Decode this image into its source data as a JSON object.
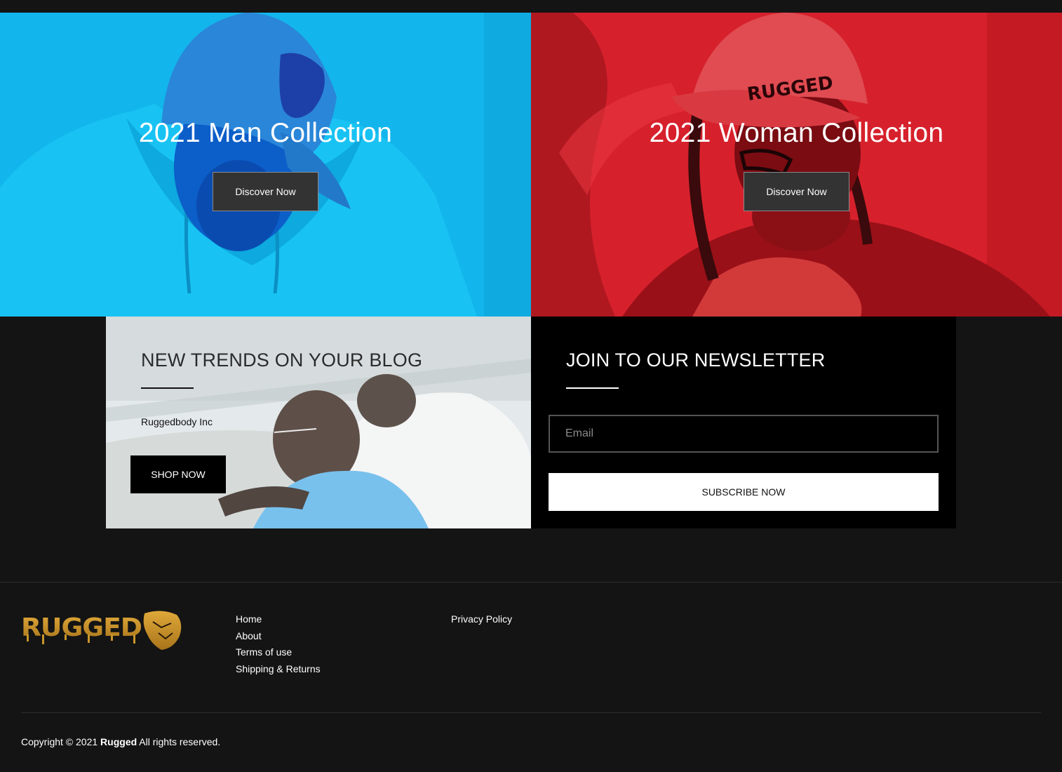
{
  "collections": {
    "man": {
      "title": "2021 Man Collection",
      "button": "Discover Now",
      "color": "#12b6ec"
    },
    "woman": {
      "title": "2021 Woman Collection",
      "button": "Discover Now",
      "color": "#d6212c"
    }
  },
  "blog": {
    "title": "NEW TRENDS ON YOUR BLOG",
    "text": "Ruggedbody Inc",
    "button": "SHOP NOW"
  },
  "newsletter": {
    "title": "JOIN TO OUR NEWSLETTER",
    "email_placeholder": "Email",
    "email_value": "",
    "button": "SUBSCRIBE NOW"
  },
  "footer": {
    "logo_text": "RUGGED",
    "links_col1": [
      "Home",
      "About",
      "Terms of use",
      "Shipping & Returns"
    ],
    "links_col2": [
      "Privacy Policy"
    ],
    "copyright_prefix": "Copyright © 2021",
    "copyright_brand": "Rugged",
    "copyright_suffix": "All rights reserved.",
    "brand_color": "#c8962a"
  }
}
